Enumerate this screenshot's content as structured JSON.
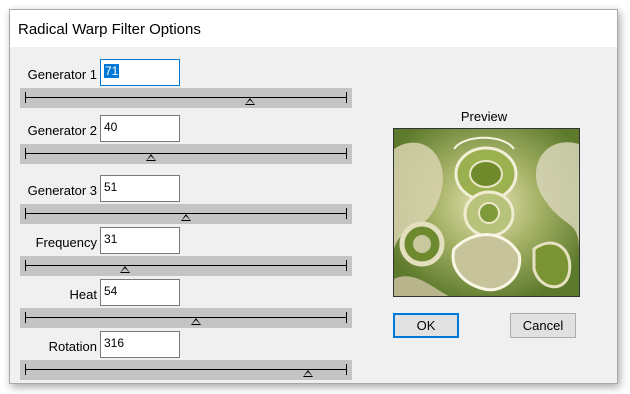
{
  "window": {
    "title": "Radical Warp Filter Options"
  },
  "sliders": [
    {
      "label": "Generator 1",
      "value": "71",
      "focused": true,
      "level": 0.7
    },
    {
      "label": "Generator 2",
      "value": "40",
      "focused": false,
      "level": 0.39
    },
    {
      "label": "Generator 3",
      "value": "51",
      "focused": false,
      "level": 0.5
    },
    {
      "label": "Frequency",
      "value": "31",
      "focused": false,
      "level": 0.31
    },
    {
      "label": "Heat",
      "value": "54",
      "focused": false,
      "level": 0.53
    },
    {
      "label": "Rotation",
      "value": "316",
      "focused": false,
      "level": 0.88
    }
  ],
  "preview": {
    "label": "Preview"
  },
  "buttons": {
    "ok": "OK",
    "cancel": "Cancel"
  },
  "colors": {
    "accent": "#0078d7",
    "dialog_bg": "#f0f0f0",
    "track": "#c4c4c4",
    "preview_base": "#6c8536"
  }
}
